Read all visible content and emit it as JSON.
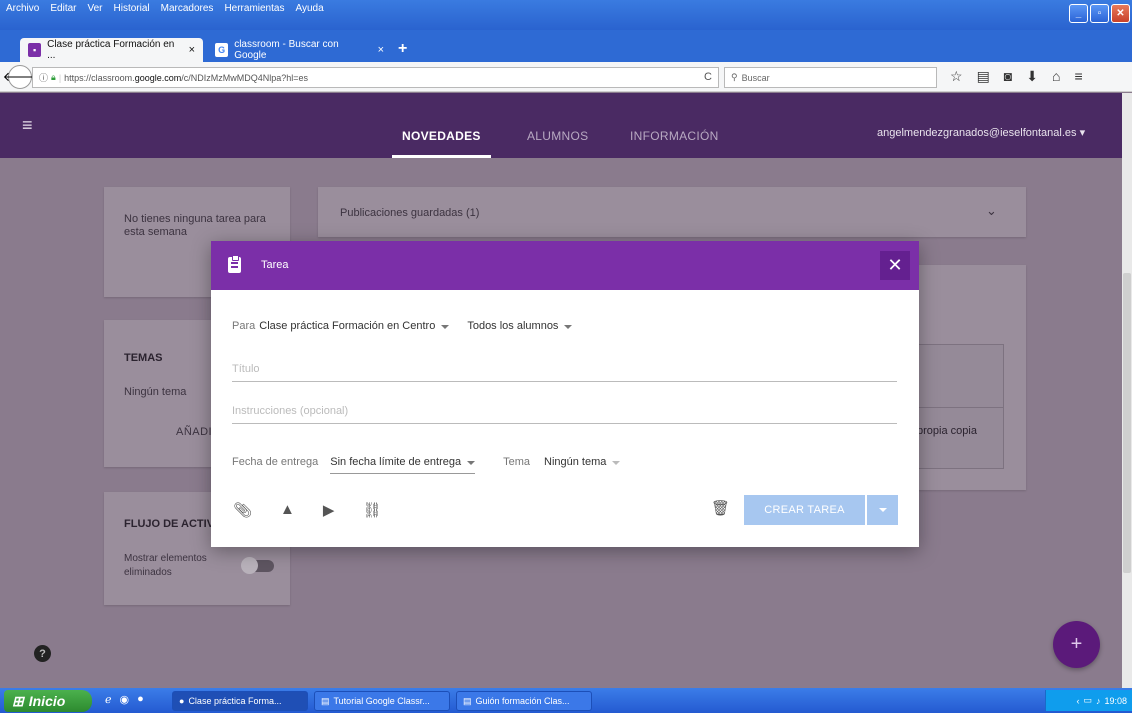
{
  "menubar": {
    "items": [
      "Archivo",
      "Editar",
      "Ver",
      "Historial",
      "Marcadores",
      "Herramientas",
      "Ayuda"
    ]
  },
  "tabs": [
    {
      "label": "Clase práctica Formación en ...",
      "close": "×"
    },
    {
      "label": "classroom - Buscar con Google",
      "close": "×"
    }
  ],
  "newtab": "+",
  "url": {
    "prefix": "https://classroom.",
    "domain": "google.com",
    "path": "/c/NDIzMzMwMDQ4Nlpa?hl=es"
  },
  "search_placeholder": "Buscar",
  "header": {
    "tabs": [
      "NOVEDADES",
      "ALUMNOS",
      "INFORMACIÓN"
    ],
    "account": "angelmendezgranados@ieselfontanal.es"
  },
  "sidebar": {
    "no_tasks": "No tienes ninguna tarea para esta semana",
    "topics_title": "TEMAS",
    "topics_empty": "Ningún tema",
    "add_partial": "AÑADI",
    "stream_title": "FLUJO DE ACTIV",
    "show_deleted": "Mostrar elementos eliminados"
  },
  "main": {
    "saved_posts": "Publicaciones guardadas (1)",
    "copy_partial": "propia copia"
  },
  "modal": {
    "title": "Tarea",
    "to_label": "Para",
    "class_value": "Clase práctica Formación en Centro",
    "students_value": "Todos los alumnos",
    "title_placeholder": "Título",
    "instructions_placeholder": "Instrucciones (opcional)",
    "due_label": "Fecha de entrega",
    "due_value": "Sin fecha límite de entrega",
    "topic_label": "Tema",
    "topic_value": "Ningún tema",
    "create_button": "CREAR TAREA"
  },
  "fab": "+",
  "help": "?",
  "taskbar": {
    "start": "Inicio",
    "tasks": [
      "Clase práctica Forma...",
      "Tutorial Google Classr...",
      "Guión formación Clas..."
    ],
    "clock": "19:08"
  }
}
